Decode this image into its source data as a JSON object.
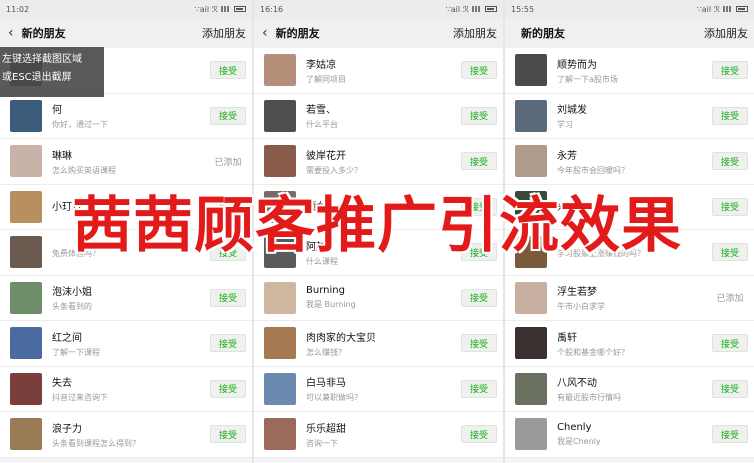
{
  "overlay_title": "茜茜顾客推广引流效果",
  "tooltip": {
    "line1": "左键选择截图区域",
    "line2": "或ESC退出截屏"
  },
  "panels": [
    {
      "status": {
        "time": "11:02",
        "carrier": "∵ail ℛ"
      },
      "nav": {
        "back": "‹",
        "title": "新的朋友",
        "action": "添加朋友"
      },
      "rows": [
        {
          "name": "",
          "msg": "",
          "action": "接受",
          "accepted": false,
          "color": "#8a8a8a"
        },
        {
          "name": "何",
          "msg": "你好，通过一下",
          "action": "接受",
          "accepted": false,
          "color": "#3a5b7a"
        },
        {
          "name": "琳琳",
          "msg": "怎么购买英语课程",
          "action": "已添加",
          "accepted": true,
          "color": "#c9b3a8"
        },
        {
          "name": "小玎玎",
          "msg": "",
          "action": "接受",
          "accepted": false,
          "color": "#b89060"
        },
        {
          "name": "",
          "msg": "兔费体验吗？",
          "action": "接受",
          "accepted": false,
          "color": "#6b5a4f"
        },
        {
          "name": "泡沫小姐",
          "msg": "头条看到的",
          "action": "接受",
          "accepted": false,
          "color": "#6f8f6a"
        },
        {
          "name": "红之间",
          "msg": "了解一下课程",
          "action": "接受",
          "accepted": false,
          "color": "#4a6aa0"
        },
        {
          "name": "失去",
          "msg": "抖音过来咨询下",
          "action": "接受",
          "accepted": false,
          "color": "#7a3f3a"
        },
        {
          "name": "浪子力",
          "msg": "头条看到课程怎么得到？",
          "action": "接受",
          "accepted": false,
          "color": "#9a7a55"
        }
      ]
    },
    {
      "status": {
        "time": "16:16",
        "carrier": "∵ail ℛ"
      },
      "nav": {
        "back": "‹",
        "title": "新的朋友",
        "action": "添加朋友"
      },
      "rows": [
        {
          "name": "李姑凉",
          "msg": "了解同项目",
          "action": "接受",
          "accepted": false,
          "color": "#b58f7a"
        },
        {
          "name": "若雪、",
          "msg": "什么平台",
          "action": "接受",
          "accepted": false,
          "color": "#4f4f4f"
        },
        {
          "name": "彼岸花开",
          "msg": "需要投入多少？",
          "action": "接受",
          "accepted": false,
          "color": "#8a5a4a"
        },
        {
          "name": "颂女",
          "msg": "",
          "action": "接受",
          "accepted": false,
          "color": "#7a6a6a"
        },
        {
          "name": "阿越",
          "msg": "什么课程",
          "action": "接受",
          "accepted": false,
          "color": "#5a5a5a"
        },
        {
          "name": "Burning",
          "msg": "我是 Burning",
          "action": "接受",
          "accepted": false,
          "color": "#d0b8a0"
        },
        {
          "name": "肉肉家的大宝贝",
          "msg": "怎么赚钱？",
          "action": "接受",
          "accepted": false,
          "color": "#a57a50"
        },
        {
          "name": "白马非马",
          "msg": "可以兼职做吗？",
          "action": "接受",
          "accepted": false,
          "color": "#6a8ab0"
        },
        {
          "name": "乐乐超甜",
          "msg": "咨询一下",
          "action": "接受",
          "accepted": false,
          "color": "#9a6a5a"
        }
      ]
    },
    {
      "status": {
        "time": "15:55",
        "carrier": "∵ail ℛ"
      },
      "nav": {
        "back": "",
        "title": "新的朋友",
        "action": "添加朋友"
      },
      "rows": [
        {
          "name": "顺势而为",
          "msg": "了解一下a股市场",
          "action": "接受",
          "accepted": false,
          "color": "#4a4a4a"
        },
        {
          "name": "刘城发",
          "msg": "学习",
          "action": "接受",
          "accepted": false,
          "color": "#5a6a7a"
        },
        {
          "name": "永芳",
          "msg": "今年股市会回暖吗？",
          "action": "接受",
          "accepted": false,
          "color": "#b09a8a"
        },
        {
          "name": "兴宏",
          "msg": "",
          "action": "接受",
          "accepted": false,
          "color": "#3a4a3a"
        },
        {
          "name": "",
          "msg": "学习股票上涨赚钱的吗？",
          "action": "接受",
          "accepted": false,
          "color": "#7a5a3a"
        },
        {
          "name": "浮生若梦",
          "msg": "牛市小白求学",
          "action": "已添加",
          "accepted": true,
          "color": "#c8b0a0"
        },
        {
          "name": "禹轩",
          "msg": "个股和基金哪个好？",
          "action": "接受",
          "accepted": false,
          "color": "#3a3030"
        },
        {
          "name": "八风不动",
          "msg": "有最近股市行情吗",
          "action": "接受",
          "accepted": false,
          "color": "#6a7060"
        },
        {
          "name": "Chenly",
          "msg": "我是Chenly",
          "action": "接受",
          "accepted": false,
          "color": "#9a9a9a"
        }
      ]
    }
  ]
}
